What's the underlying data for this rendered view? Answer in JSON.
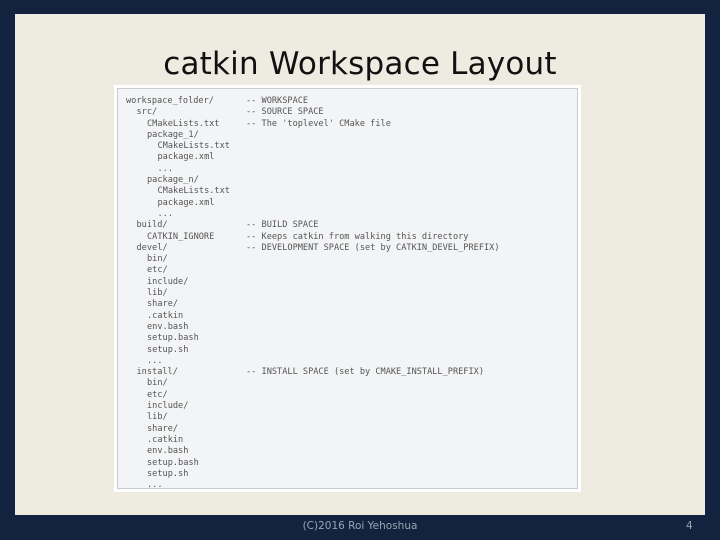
{
  "title": "catkin Workspace Layout",
  "footer": {
    "copyright": "(C)2016 Roi Yehoshua",
    "page_number": "4"
  },
  "colors": {
    "frame": "#13233f",
    "slide": "#eeebe1",
    "code_bg": "#f3f4f6"
  },
  "tree": [
    {
      "indent": 0,
      "path": "workspace_folder/",
      "comment": "-- WORKSPACE"
    },
    {
      "indent": 1,
      "path": "src/",
      "comment": "-- SOURCE SPACE"
    },
    {
      "indent": 2,
      "path": "CMakeLists.txt",
      "comment": "-- The 'toplevel' CMake file"
    },
    {
      "indent": 2,
      "path": "package_1/",
      "comment": ""
    },
    {
      "indent": 3,
      "path": "CMakeLists.txt",
      "comment": ""
    },
    {
      "indent": 3,
      "path": "package.xml",
      "comment": ""
    },
    {
      "indent": 3,
      "path": "...",
      "comment": ""
    },
    {
      "indent": 2,
      "path": "package_n/",
      "comment": ""
    },
    {
      "indent": 3,
      "path": "CMakeLists.txt",
      "comment": ""
    },
    {
      "indent": 3,
      "path": "package.xml",
      "comment": ""
    },
    {
      "indent": 3,
      "path": "...",
      "comment": ""
    },
    {
      "indent": 1,
      "path": "build/",
      "comment": "-- BUILD SPACE"
    },
    {
      "indent": 2,
      "path": "CATKIN_IGNORE",
      "comment": "-- Keeps catkin from walking this directory"
    },
    {
      "indent": 1,
      "path": "devel/",
      "comment": "-- DEVELOPMENT SPACE (set by CATKIN_DEVEL_PREFIX)"
    },
    {
      "indent": 2,
      "path": "bin/",
      "comment": ""
    },
    {
      "indent": 2,
      "path": "etc/",
      "comment": ""
    },
    {
      "indent": 2,
      "path": "include/",
      "comment": ""
    },
    {
      "indent": 2,
      "path": "lib/",
      "comment": ""
    },
    {
      "indent": 2,
      "path": "share/",
      "comment": ""
    },
    {
      "indent": 2,
      "path": ".catkin",
      "comment": ""
    },
    {
      "indent": 2,
      "path": "env.bash",
      "comment": ""
    },
    {
      "indent": 2,
      "path": "setup.bash",
      "comment": ""
    },
    {
      "indent": 2,
      "path": "setup.sh",
      "comment": ""
    },
    {
      "indent": 2,
      "path": "...",
      "comment": ""
    },
    {
      "indent": 1,
      "path": "install/",
      "comment": "-- INSTALL SPACE (set by CMAKE_INSTALL_PREFIX)"
    },
    {
      "indent": 2,
      "path": "bin/",
      "comment": ""
    },
    {
      "indent": 2,
      "path": "etc/",
      "comment": ""
    },
    {
      "indent": 2,
      "path": "include/",
      "comment": ""
    },
    {
      "indent": 2,
      "path": "lib/",
      "comment": ""
    },
    {
      "indent": 2,
      "path": "share/",
      "comment": ""
    },
    {
      "indent": 2,
      "path": ".catkin",
      "comment": ""
    },
    {
      "indent": 2,
      "path": "env.bash",
      "comment": ""
    },
    {
      "indent": 2,
      "path": "setup.bash",
      "comment": ""
    },
    {
      "indent": 2,
      "path": "setup.sh",
      "comment": ""
    },
    {
      "indent": 2,
      "path": "...",
      "comment": ""
    }
  ]
}
